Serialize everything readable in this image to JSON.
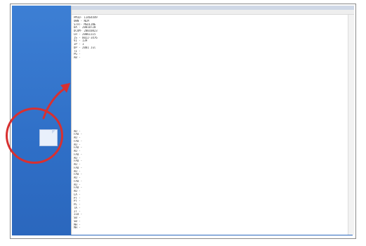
{
  "window": {
    "title": "",
    "menu": ""
  },
  "desktop_icon": {
    "label": ""
  },
  "content_lines": [
    "PMID- 11464449",
    "OWN - NLM",
    "STAT- MEDLINE",
    "DA  - 20010720",
    "DCOM- 20010823",
    "LR  - 20061115",
    "IS  - 0022-3476",
    "VI  - 139",
    "IP  - 1",
    "DP  - 2001 Jul",
    "TI  - ",
    "PG  - ",
    "AB  - ",
    "   ",
    "   ",
    "   ",
    "   ",
    "   ",
    "   ",
    "   ",
    "   ",
    "   ",
    "   ",
    "   ",
    "   ",
    "   ",
    "   ",
    "   ",
    "   ",
    "   ",
    "   ",
    "   ",
    "   ",
    "   ",
    "AD  - ",
    "FAU - ",
    "AU  - ",
    "FAU - ",
    "AU  - ",
    "FAU - ",
    "AU  - ",
    "FAU - ",
    "AU  - ",
    "FAU - ",
    "AU  - ",
    "FAU - ",
    "AU  - ",
    "FAU - ",
    "AU  - ",
    "FAU - ",
    "AU  - ",
    "FAU - ",
    "AU  - ",
    "LA  - ",
    "PT  - ",
    "PT  - ",
    "PL  - ",
    "TA  - ",
    "JT  - ",
    "JID - ",
    "SB  - ",
    "SB  - ",
    "MH  - ",
    "MH  - "
  ]
}
